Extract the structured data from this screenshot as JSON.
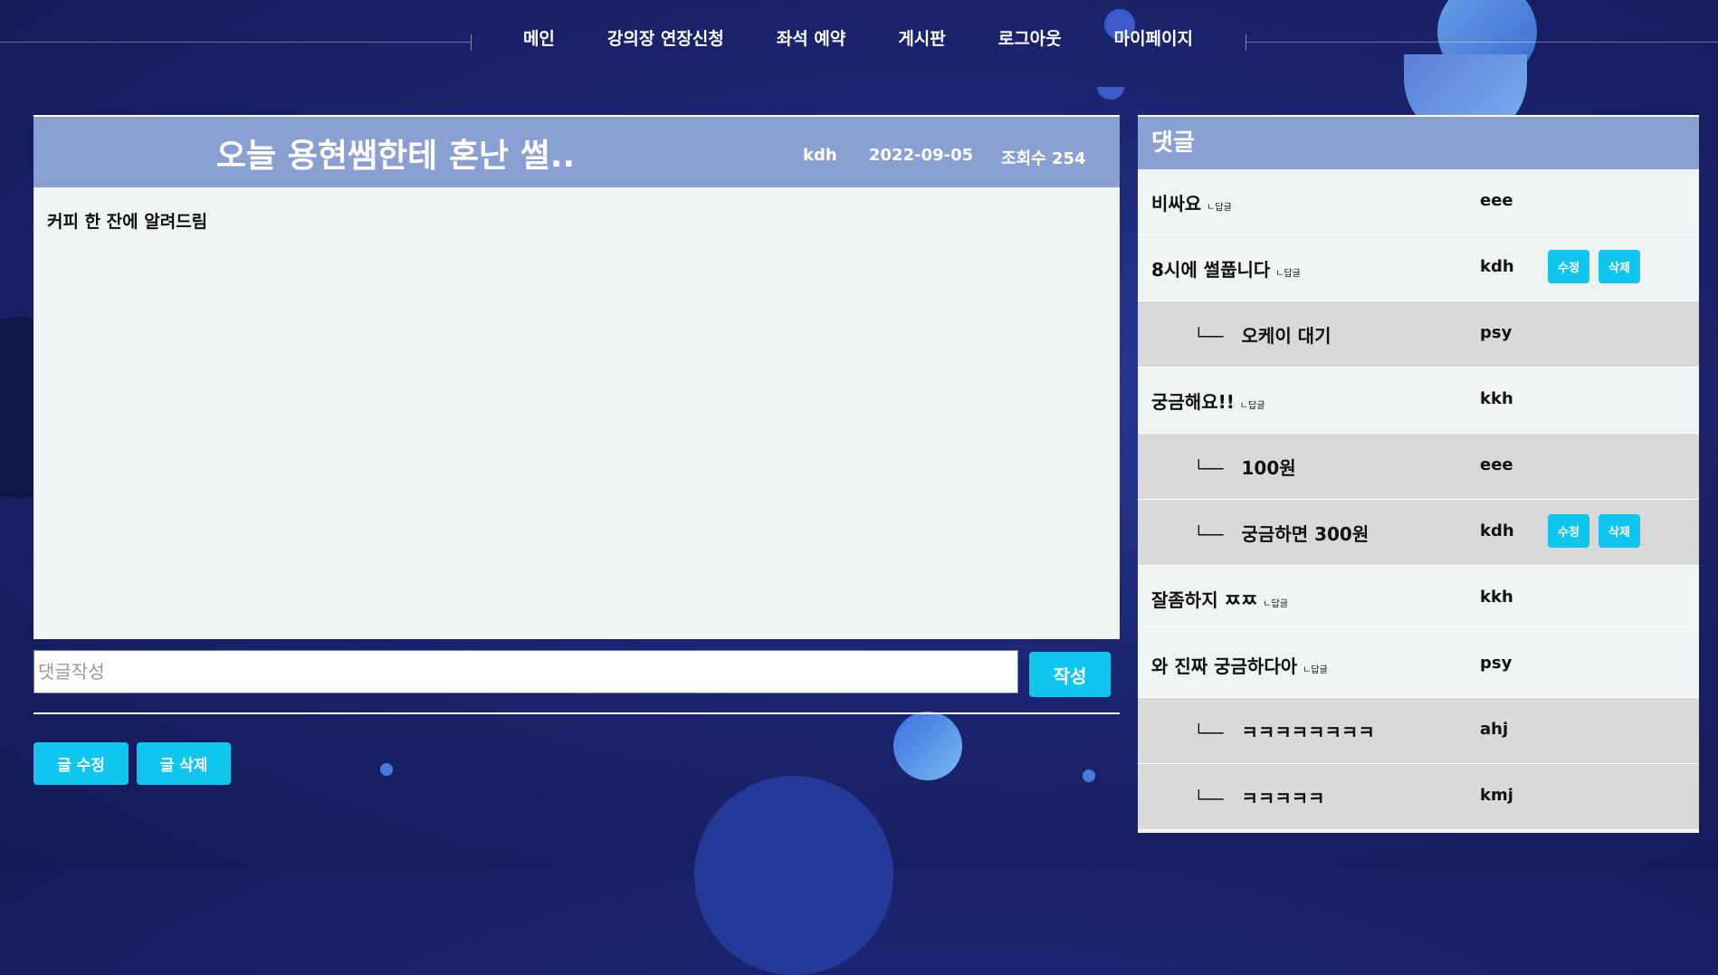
{
  "nav": {
    "items": [
      "메인",
      "강의장 연장신청",
      "좌석 예약",
      "게시판",
      "로그아웃",
      "마이페이지"
    ]
  },
  "post": {
    "title": "오늘 용현쌤한테 혼난 썰..",
    "author": "kdh",
    "date": "2022-09-05",
    "views": "조회수 254",
    "content": "커피 한 잔에 알려드림"
  },
  "comment_form": {
    "placeholder": "댓글작성",
    "value": "",
    "submit_label": "작성"
  },
  "post_actions": {
    "edit_label": "글 수정",
    "delete_label": "글 삭제"
  },
  "comments": {
    "title": "댓글",
    "reply_label": "ㄴ답글",
    "reply_arrow": "└──",
    "edit_label": "수정",
    "delete_label": "삭제",
    "items": [
      {
        "text": "비싸요",
        "author": "eee",
        "reply": false,
        "own": false
      },
      {
        "text": "8시에 썰풉니다",
        "author": "kdh",
        "reply": false,
        "own": true
      },
      {
        "text": "오케이 대기",
        "author": "psy",
        "reply": true,
        "own": false
      },
      {
        "text": "궁금해요!!",
        "author": "kkh",
        "reply": false,
        "own": false
      },
      {
        "text": "100원",
        "author": "eee",
        "reply": true,
        "own": false
      },
      {
        "text": "궁금하면 300원",
        "author": "kdh",
        "reply": true,
        "own": true
      },
      {
        "text": "잘좀하지 ㅉㅉ",
        "author": "kkh",
        "reply": false,
        "own": false
      },
      {
        "text": "와 진짜 궁금하다아",
        "author": "psy",
        "reply": false,
        "own": false
      },
      {
        "text": "ㅋㅋㅋㅋㅋㅋㅋㅋ",
        "author": "ahj",
        "reply": true,
        "own": false
      },
      {
        "text": "ㅋㅋㅋㅋㅋ",
        "author": "kmj",
        "reply": true,
        "own": false
      }
    ]
  },
  "colors": {
    "accent": "#0fc6ef",
    "header": "#8aa0d2",
    "background": "#1b2470"
  }
}
